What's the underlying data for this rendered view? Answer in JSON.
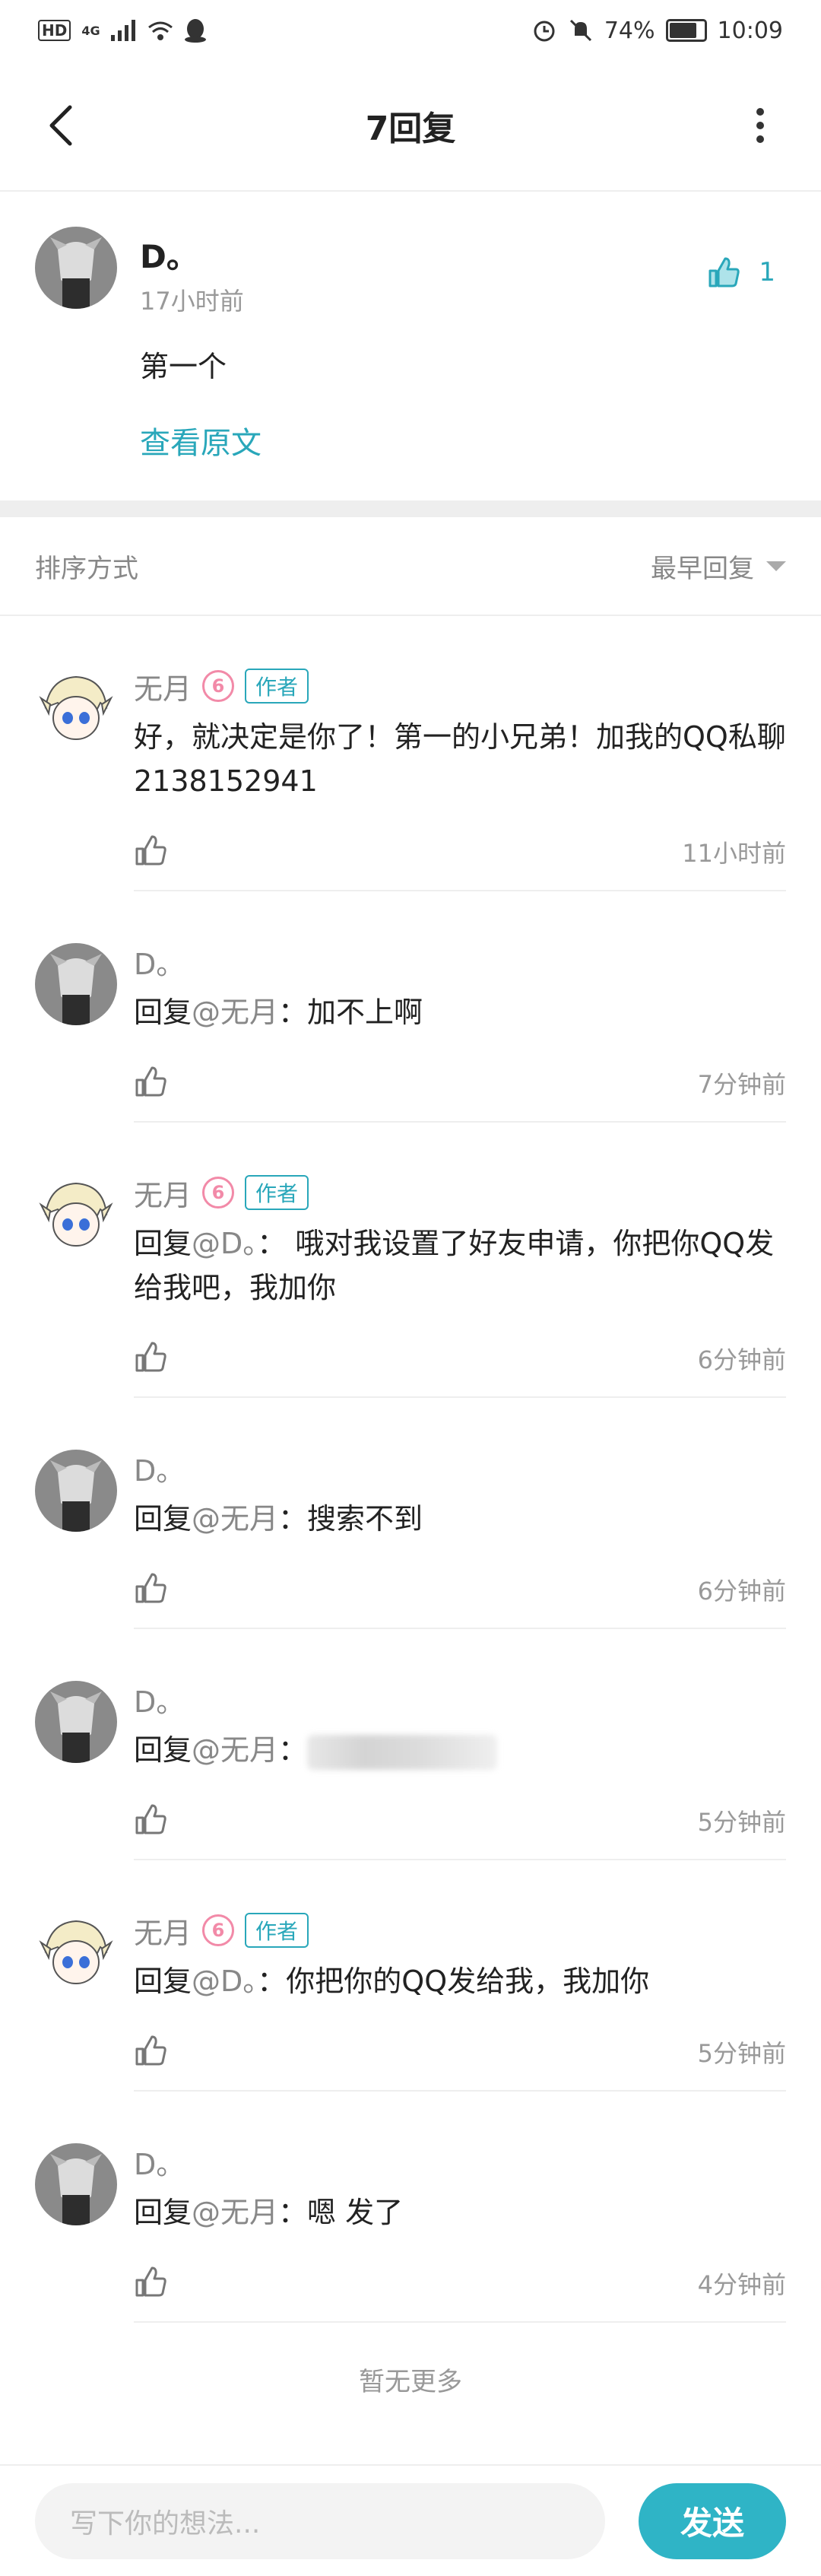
{
  "status_bar": {
    "left_badge": "HD",
    "network": "4G",
    "battery_percent": "74%",
    "battery_level": 0.74,
    "time": "10:09",
    "icons": [
      "signal-icon",
      "wifi-icon",
      "qq-icon",
      "alarm-icon",
      "mute-icon",
      "battery-icon"
    ]
  },
  "nav": {
    "title": "7回复",
    "back_icon": "back-arrow-icon",
    "more_icon": "more-vertical-icon"
  },
  "origin": {
    "name": "D。",
    "time": "17小时前",
    "text": "第一个",
    "view_original": "查看原文",
    "likes": "1"
  },
  "sort": {
    "label": "排序方式",
    "value": "最早回复"
  },
  "replies": [
    {
      "type": "author",
      "name": "无月",
      "level": "6",
      "badge": "作者",
      "prefix": "",
      "target": "",
      "text": "好，就决定是你了！第一的小兄弟！加我的QQ私聊2138152941",
      "time": "11小时前"
    },
    {
      "type": "user",
      "name": "D。",
      "prefix": "回复",
      "target": "@无月",
      "text": "：加不上啊",
      "time": "7分钟前"
    },
    {
      "type": "author",
      "name": "无月",
      "level": "6",
      "badge": "作者",
      "prefix": "回复",
      "target": "@D。",
      "text": "： 哦对我设置了好友申请，你把你QQ发给我吧，我加你",
      "time": "6分钟前"
    },
    {
      "type": "user",
      "name": "D。",
      "prefix": "回复",
      "target": "@无月",
      "text": "：搜索不到",
      "time": "6分钟前"
    },
    {
      "type": "user",
      "name": "D。",
      "prefix": "回复",
      "target": "@无月",
      "text": "：",
      "time": "5分钟前"
    },
    {
      "type": "author",
      "name": "无月",
      "level": "6",
      "badge": "作者",
      "prefix": "回复",
      "target": "@D。",
      "text": "：你把你的QQ发给我，我加你",
      "time": "5分钟前"
    },
    {
      "type": "user",
      "name": "D。",
      "prefix": "回复",
      "target": "@无月",
      "text": "：嗯 发了",
      "time": "4分钟前"
    }
  ],
  "no_more": "暂无更多",
  "composer": {
    "placeholder": "写下你的想法...",
    "send_label": "发送"
  },
  "colors": {
    "accent": "#29a7ba",
    "send_button": "#2fb4c6",
    "level_badge": "#f28aa8"
  }
}
